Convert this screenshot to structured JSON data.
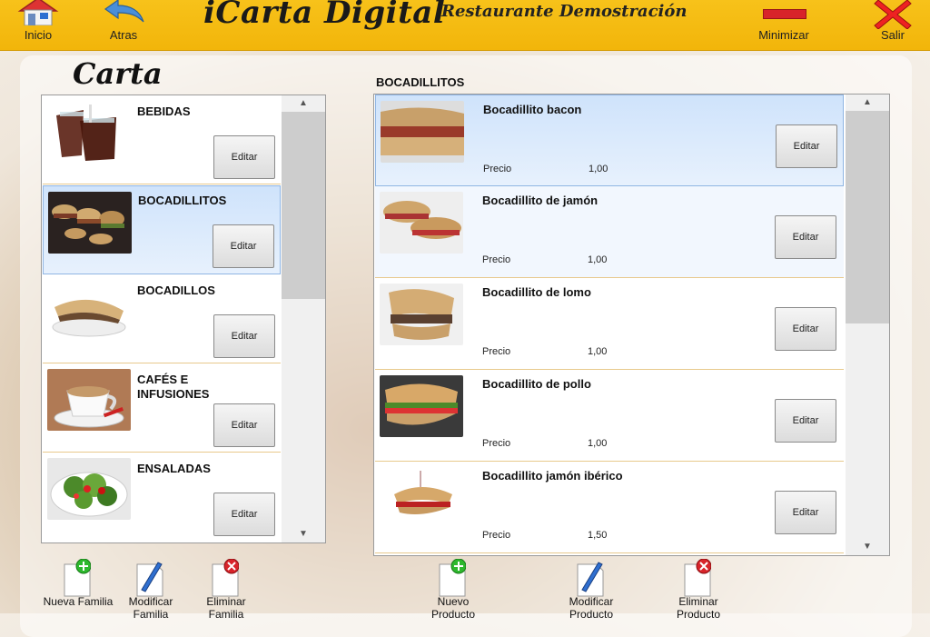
{
  "header": {
    "inicio_label": "Inicio",
    "atras_label": "Atras",
    "app_title": "iCarta Digital",
    "restaurant_name": "Restaurante Demostración",
    "minimizar_label": "Minimizar",
    "salir_label": "Salir"
  },
  "carta": {
    "title": "Carta",
    "families": [
      {
        "name": "BEBIDAS",
        "edit": "Editar"
      },
      {
        "name": "BOCADILLITOS",
        "edit": "Editar"
      },
      {
        "name": "BOCADILLOS",
        "edit": "Editar"
      },
      {
        "name": "CAFÉS E INFUSIONES",
        "edit": "Editar"
      },
      {
        "name": "ENSALADAS",
        "edit": "Editar"
      }
    ]
  },
  "products": {
    "section_title": "BOCADILLITOS",
    "price_label": "Precio",
    "items": [
      {
        "name": "Bocadillito bacon",
        "price": "1,00",
        "edit": "Editar"
      },
      {
        "name": "Bocadillito de jamón",
        "price": "1,00",
        "edit": "Editar"
      },
      {
        "name": "Bocadillito de lomo",
        "price": "1,00",
        "edit": "Editar"
      },
      {
        "name": "Bocadillito de pollo",
        "price": "1,00",
        "edit": "Editar"
      },
      {
        "name": "Bocadillito jamón ibérico",
        "price": "1,50",
        "edit": "Editar"
      }
    ]
  },
  "toolbar": {
    "nueva_familia": "Nueva Familia",
    "modificar_familia": "Modificar Familia",
    "eliminar_familia": "Eliminar Familia",
    "nuevo_producto": "Nuevo Producto",
    "modificar_producto": "Modificar Producto",
    "eliminar_producto": "Eliminar Producto"
  },
  "colors": {
    "topbar": "#f2b50a",
    "selection": "#cfe3fb",
    "add_green": "#2db82d",
    "delete_red": "#d8242a"
  }
}
